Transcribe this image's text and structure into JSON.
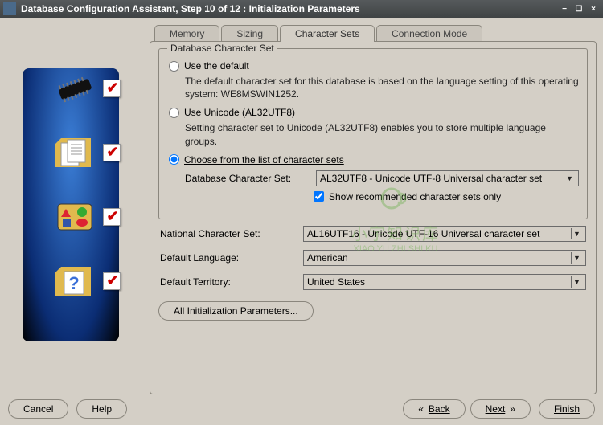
{
  "window": {
    "title": "Database Configuration Assistant, Step 10 of 12 : Initialization Parameters"
  },
  "tabs": {
    "memory": "Memory",
    "sizing": "Sizing",
    "charsets": "Character Sets",
    "connmode": "Connection Mode"
  },
  "group": {
    "title": "Database Character Set",
    "useDefault": {
      "label": "Use the default",
      "desc": "The default character set for this database is based on the language setting of this operating system: WE8MSWIN1252."
    },
    "useUnicode": {
      "label": "Use Unicode (AL32UTF8)",
      "desc": "Setting character set to Unicode (AL32UTF8) enables you to store multiple language groups."
    },
    "chooseList": {
      "label": "Choose from the list of character sets",
      "dbCharsetLabel": "Database Character Set:",
      "dbCharsetValue": "AL32UTF8 - Unicode UTF-8 Universal character set",
      "showRecommended": "Show recommended character sets only"
    }
  },
  "fields": {
    "natCharsetLabel": "National Character Set:",
    "natCharsetValue": "AL16UTF16 - Unicode UTF-16 Universal character set",
    "defLangLabel": "Default Language:",
    "defLangValue": "American",
    "defTerrLabel": "Default Territory:",
    "defTerrValue": "United States"
  },
  "buttons": {
    "allParams": "All Initialization Parameters...",
    "cancel": "Cancel",
    "help": "Help",
    "back": "Back",
    "next": "Next",
    "finish": "Finish"
  },
  "nav": {
    "backGlyph": "«",
    "nextGlyph": "»"
  },
  "watermark": {
    "line1": "小宇知识库",
    "line2": "XIAO YU ZHI SHI KU"
  }
}
